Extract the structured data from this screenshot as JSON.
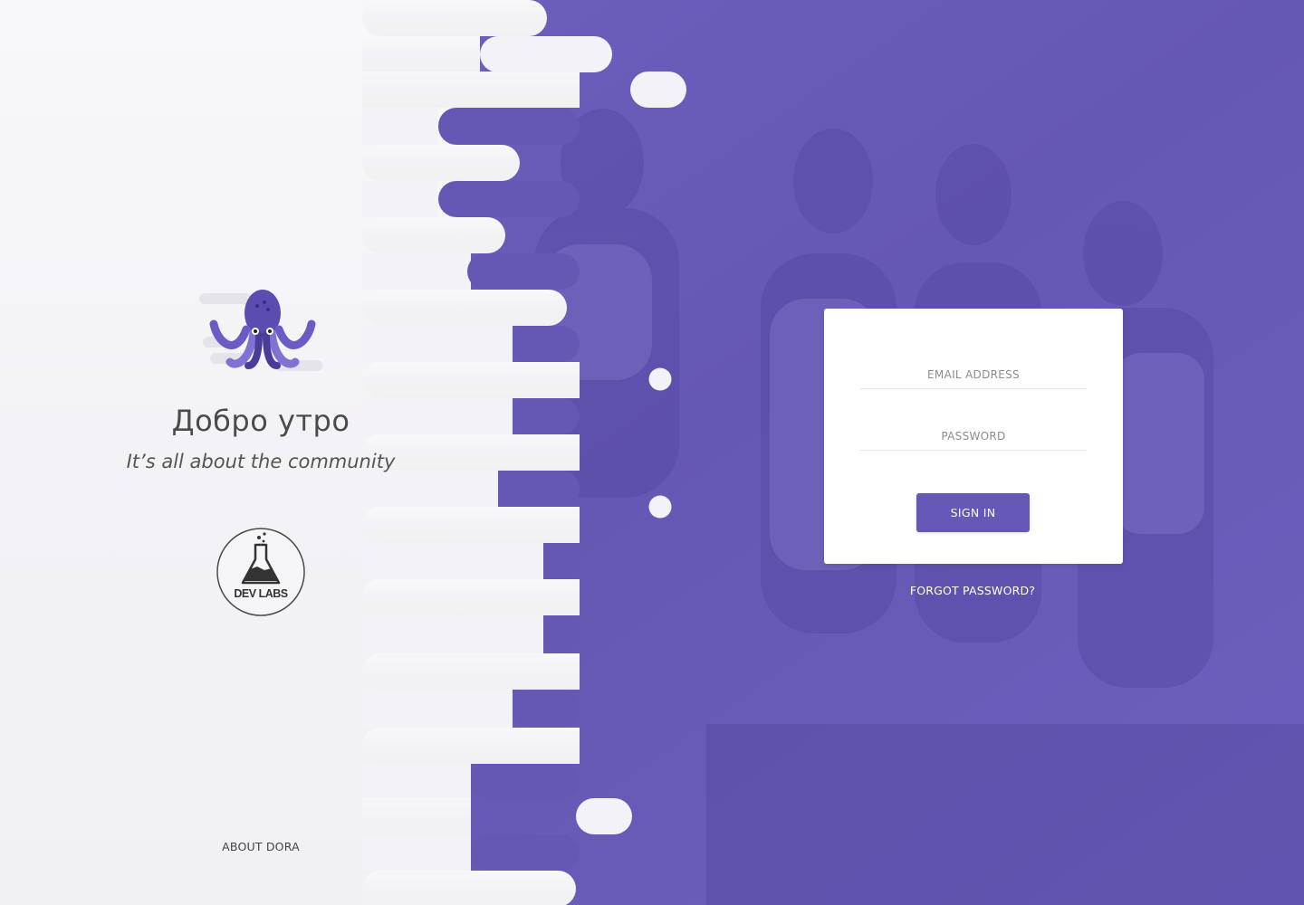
{
  "left": {
    "greeting": "Добро утро",
    "tagline": "It’s all about the community",
    "partner_logo_text": "DEV LABS",
    "about_link": "ABOUT DORA"
  },
  "login": {
    "email_placeholder": "EMAIL ADDRESS",
    "password_placeholder": "PASSWORD",
    "signin_label": "SIGN IN",
    "forgot_label": "FORGOT PASSWORD?"
  },
  "icons": {
    "brand_logo": "octopus-logo-icon",
    "partner_logo": "flask-logo-icon"
  },
  "colors": {
    "accent": "#6658b6",
    "overlay": "#6a5cba",
    "left_wash": "#f4f3f7",
    "text_dark": "#4b4b4b"
  }
}
